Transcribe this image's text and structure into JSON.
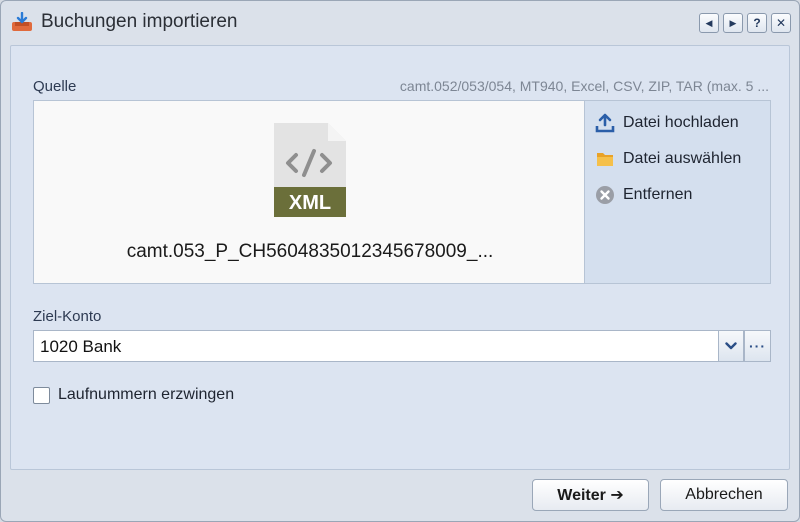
{
  "window": {
    "title": "Buchungen importieren",
    "title_icon": "import-tray-icon",
    "controls": [
      {
        "name": "prev-icon",
        "glyph": "◀"
      },
      {
        "name": "next-icon",
        "glyph": "▶"
      },
      {
        "name": "help-icon",
        "glyph": "?"
      },
      {
        "name": "close-icon",
        "glyph": "✕"
      }
    ]
  },
  "source": {
    "label": "Quelle",
    "formats": "camt.052/053/054, MT940, Excel, CSV, ZIP, TAR (max. 5 ...",
    "file_badge": "XML",
    "file_name": "camt.053_P_CH5604835012345678009_...",
    "actions": [
      {
        "label": "Datei hochladen",
        "icon": "upload-icon"
      },
      {
        "label": "Datei auswählen",
        "icon": "folder-icon"
      },
      {
        "label": "Entfernen",
        "icon": "remove-icon"
      }
    ]
  },
  "target": {
    "label": "Ziel-Konto",
    "value": "1020 Bank",
    "more_glyph": "···"
  },
  "options": {
    "force_sequence_label": "Laufnummern erzwingen",
    "force_sequence_checked": false
  },
  "footer": {
    "next_label": "Weiter ➔",
    "cancel_label": "Abbrechen"
  },
  "colors": {
    "accent": "#2a5ea8",
    "file_badge": "#6b6f3a"
  }
}
